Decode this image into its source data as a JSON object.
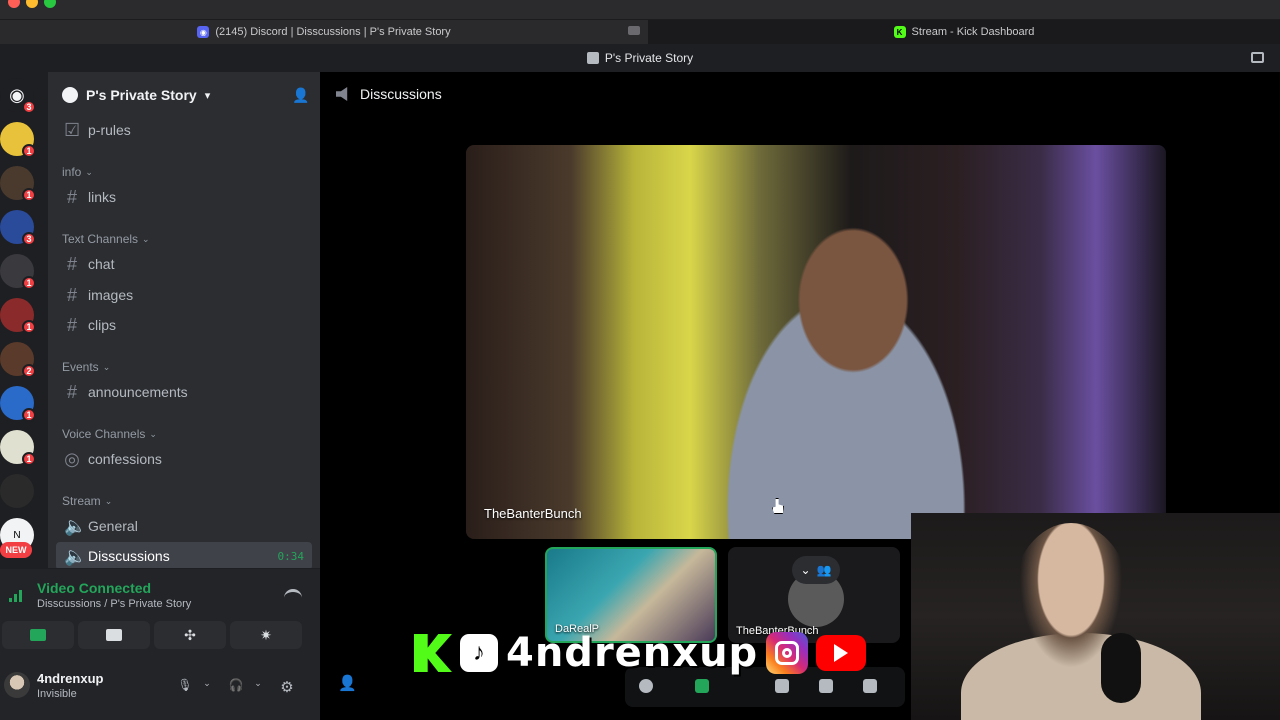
{
  "browser": {
    "tabs": [
      {
        "label": "(2145) Discord | Disscussions | P's Private Story",
        "favicon": "discord-icon",
        "color": "#5865f2"
      },
      {
        "label": "Stream - Kick Dashboard",
        "favicon": "kick-icon",
        "color": "#53fc18"
      }
    ]
  },
  "window": {
    "title": "P's Private Story"
  },
  "servers": {
    "badges": [
      "3",
      "1",
      "1",
      "3",
      "1",
      "1",
      "2",
      "1",
      "1"
    ],
    "new_label": "NEW"
  },
  "sidebar": {
    "guild_name": "P's Private Story",
    "rules_channel": "p-rules",
    "categories": {
      "info": "info",
      "text": "Text Channels",
      "events": "Events",
      "voice": "Voice Channels",
      "stream": "Stream"
    },
    "channels": {
      "links": "links",
      "chat": "chat",
      "images": "images",
      "clips": "clips",
      "announcements": "announcements",
      "confessions": "confessions",
      "general": "General",
      "disscussions": "Disscussions",
      "timer": "0:34"
    }
  },
  "voice_panel": {
    "status": "Video Connected",
    "location": "Disscussions / P's Private Story"
  },
  "user": {
    "name": "4ndrenxup",
    "status": "Invisible"
  },
  "call": {
    "channel": "Disscussions",
    "main_participant": "TheBanterBunch",
    "thumbnails": [
      {
        "label": "DaRealP"
      },
      {
        "label": "TheBanterBunch"
      }
    ]
  },
  "overlay": {
    "handle": "4ndrenxup"
  },
  "colors": {
    "accent_green": "#23a55a",
    "kick_green": "#53fc18",
    "badge_red": "#f23f43"
  }
}
